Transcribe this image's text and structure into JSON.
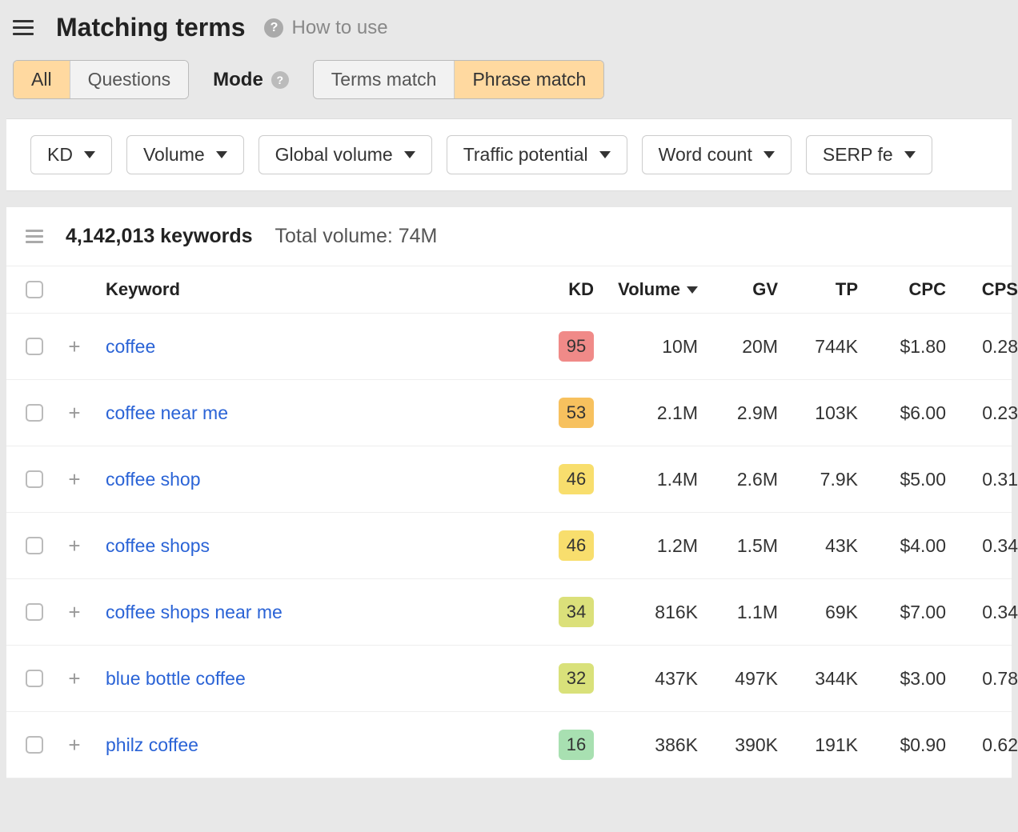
{
  "header": {
    "title": "Matching terms",
    "how_to_use": "How to use"
  },
  "type_tabs": {
    "all": "All",
    "questions": "Questions",
    "active": "all"
  },
  "mode": {
    "label": "Mode",
    "terms_match": "Terms match",
    "phrase_match": "Phrase match",
    "active": "phrase_match"
  },
  "filters": [
    "KD",
    "Volume",
    "Global volume",
    "Traffic potential",
    "Word count",
    "SERP fe"
  ],
  "summary": {
    "keyword_count": "4,142,013 keywords",
    "total_volume": "Total volume: 74M"
  },
  "columns": {
    "keyword": "Keyword",
    "kd": "KD",
    "volume": "Volume",
    "gv": "GV",
    "tp": "TP",
    "cpc": "CPC",
    "cps": "CPS"
  },
  "kd_colors": {
    "95": "#f08a88",
    "53": "#f7c15e",
    "46": "#f8de6d",
    "34": "#dbe07a",
    "32": "#d9e17a",
    "16": "#a8e0b1"
  },
  "rows": [
    {
      "keyword": "coffee",
      "kd": "95",
      "volume": "10M",
      "gv": "20M",
      "tp": "744K",
      "cpc": "$1.80",
      "cps": "0.28"
    },
    {
      "keyword": "coffee near me",
      "kd": "53",
      "volume": "2.1M",
      "gv": "2.9M",
      "tp": "103K",
      "cpc": "$6.00",
      "cps": "0.23"
    },
    {
      "keyword": "coffee shop",
      "kd": "46",
      "volume": "1.4M",
      "gv": "2.6M",
      "tp": "7.9K",
      "cpc": "$5.00",
      "cps": "0.31"
    },
    {
      "keyword": "coffee shops",
      "kd": "46",
      "volume": "1.2M",
      "gv": "1.5M",
      "tp": "43K",
      "cpc": "$4.00",
      "cps": "0.34"
    },
    {
      "keyword": "coffee shops near me",
      "kd": "34",
      "volume": "816K",
      "gv": "1.1M",
      "tp": "69K",
      "cpc": "$7.00",
      "cps": "0.34"
    },
    {
      "keyword": "blue bottle coffee",
      "kd": "32",
      "volume": "437K",
      "gv": "497K",
      "tp": "344K",
      "cpc": "$3.00",
      "cps": "0.78"
    },
    {
      "keyword": "philz coffee",
      "kd": "16",
      "volume": "386K",
      "gv": "390K",
      "tp": "191K",
      "cpc": "$0.90",
      "cps": "0.62"
    }
  ]
}
